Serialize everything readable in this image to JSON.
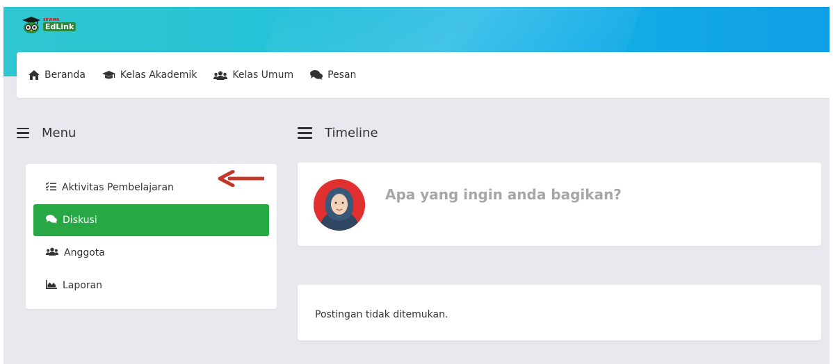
{
  "brand": {
    "small_text": "SEVIMA",
    "name": "EdLink"
  },
  "nav": {
    "items": [
      {
        "label": "Beranda",
        "icon": "home-icon"
      },
      {
        "label": "Kelas Akademik",
        "icon": "graduation-cap-icon"
      },
      {
        "label": "Kelas Umum",
        "icon": "users-icon"
      },
      {
        "label": "Pesan",
        "icon": "comments-icon"
      }
    ]
  },
  "menu": {
    "title": "Menu",
    "items": [
      {
        "label": "Aktivitas Pembelajaran",
        "icon": "tasks-icon",
        "active": false
      },
      {
        "label": "Diskusi",
        "icon": "comments-icon",
        "active": true
      },
      {
        "label": "Anggota",
        "icon": "users-icon",
        "active": false
      },
      {
        "label": "Laporan",
        "icon": "area-chart-icon",
        "active": false
      }
    ]
  },
  "timeline": {
    "title": "Timeline",
    "composer_placeholder": "Apa yang ingin anda bagikan?",
    "empty_message": "Postingan tidak ditemukan."
  },
  "colors": {
    "accent": "#28a745",
    "header_start": "#2ec6d0",
    "header_end": "#0f9fe6",
    "annotation_arrow": "#c0392b"
  }
}
